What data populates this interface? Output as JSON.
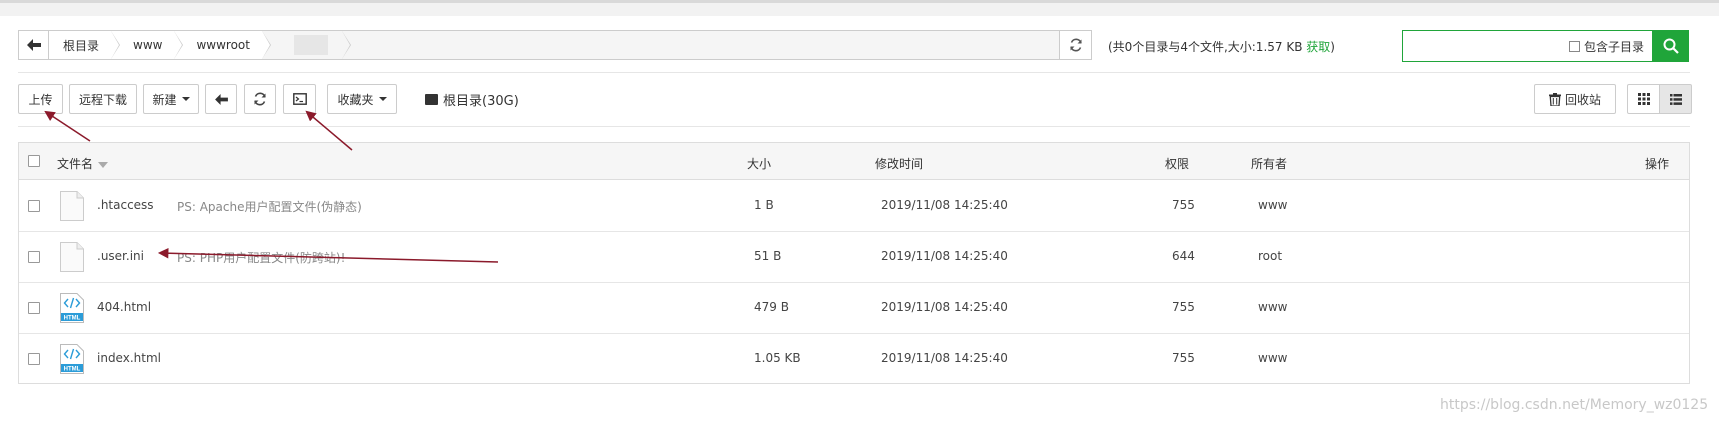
{
  "breadcrumb": {
    "items": [
      "根目录",
      "www",
      "wwwroot"
    ]
  },
  "summary": {
    "text": "(共0个目录与4个文件,大小:1.57 KB ",
    "link": "获取",
    "close": ")"
  },
  "search": {
    "placeholder": "",
    "include_subdir_label": "包含子目录"
  },
  "toolbar": {
    "upload": "上传",
    "remote_download": "远程下载",
    "new": "新建",
    "favorites": "收藏夹",
    "disk": "根目录(30G)",
    "recycle_bin": "回收站"
  },
  "table": {
    "headers": {
      "name": "文件名",
      "size": "大小",
      "modified": "修改时间",
      "permission": "权限",
      "owner": "所有者",
      "actions": "操作"
    },
    "rows": [
      {
        "name": ".htaccess",
        "desc": "PS: Apache用户配置文件(伪静态)",
        "size": "1 B",
        "modified": "2019/11/08 14:25:40",
        "permission": "755",
        "owner": "www",
        "icon": "file-icon"
      },
      {
        "name": ".user.ini",
        "desc": "PS: PHP用户配置文件(防跨站)!",
        "size": "51 B",
        "modified": "2019/11/08 14:25:40",
        "permission": "644",
        "owner": "root",
        "icon": "file-icon"
      },
      {
        "name": "404.html",
        "desc": "",
        "size": "479 B",
        "modified": "2019/11/08 14:25:40",
        "permission": "755",
        "owner": "www",
        "icon": "html-file-icon"
      },
      {
        "name": "index.html",
        "desc": "",
        "size": "1.05 KB",
        "modified": "2019/11/08 14:25:40",
        "permission": "755",
        "owner": "www",
        "icon": "html-file-icon"
      }
    ]
  },
  "html_icon_label": "HTML",
  "watermark": "https://blog.csdn.net/Memory_wz0125",
  "colors": {
    "accent": "#20a53a",
    "arrow": "#8b1a2b"
  }
}
